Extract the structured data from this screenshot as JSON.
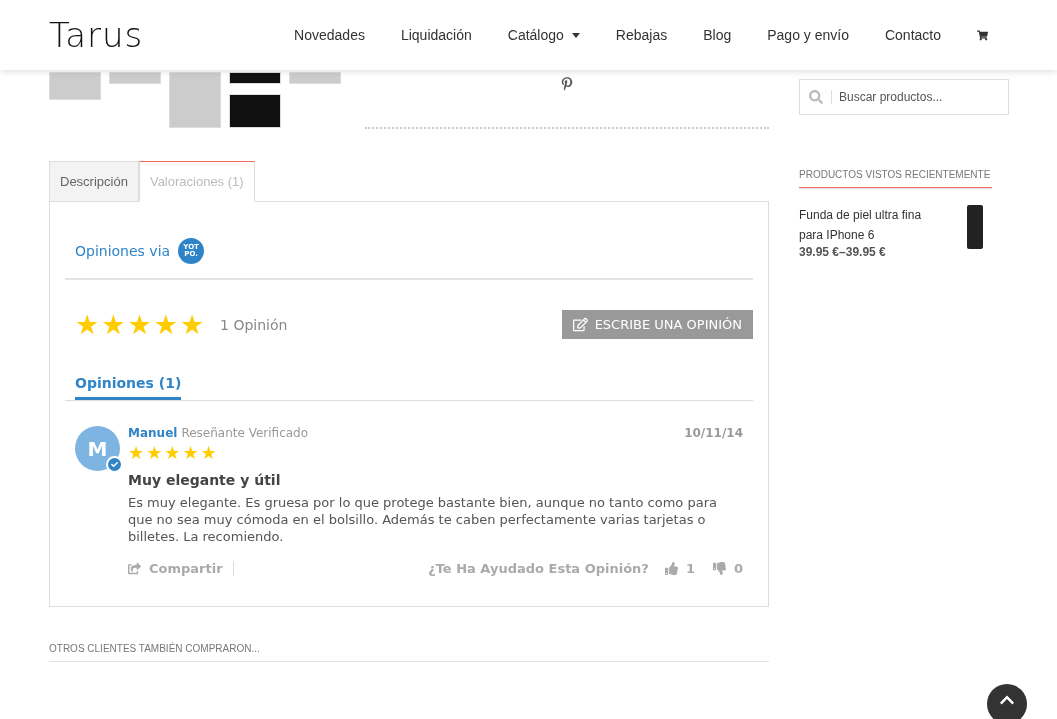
{
  "header": {
    "logo": "Tarus",
    "nav": [
      {
        "label": "Novedades",
        "kind": "link"
      },
      {
        "label": "Liquidación",
        "kind": "link"
      },
      {
        "label": "Catálogo",
        "kind": "dropdown"
      },
      {
        "label": "Rebajas",
        "kind": "link"
      },
      {
        "label": "Blog",
        "kind": "link"
      },
      {
        "label": "Pago y envío",
        "kind": "link"
      },
      {
        "label": "Contacto",
        "kind": "link"
      },
      {
        "kind": "cart"
      }
    ]
  },
  "tabs": [
    {
      "label": "Descripción",
      "selected": false
    },
    {
      "label": "Valoraciones (1)",
      "selected": true
    }
  ],
  "reviews_widget": {
    "title": "Opiniones via",
    "badge": "YOT PO.",
    "stars": 5,
    "count": "1 Opinión",
    "write_button": "ESCRIBE UNA OPINIÓN",
    "reviews_tab": "Opiniones (1)",
    "reviews": [
      {
        "initial": "M",
        "author": "Manuel",
        "verified": true,
        "role": "Reseñante Verificado",
        "date": "10/11/14",
        "stars": 5,
        "title": "Muy elegante y útil",
        "body": "Es muy elegante. Es gruesa por lo que protege bastante bien, aunque no tanto como para que no sea muy cómoda en el bolsillo. Además te caben perfectamente varias tarjetas o billetes. La recomiendo.",
        "share": "Compartir",
        "helpful": "¿Te Ha Ayudado Esta Opinión?",
        "up": "1",
        "down": "0"
      }
    ]
  },
  "sidebar": {
    "search": {
      "placeholder": "Buscar productos..."
    },
    "recent_title": "PRODUCTOS VISTOS RECIENTEMENTE",
    "recent": [
      {
        "name": "Funda de piel ultra fina para IPhone 6",
        "price": "39.95 €–39.95 €"
      }
    ]
  },
  "related_title": "OTROS CLIENTES TAMBIÉN COMPRARON..."
}
